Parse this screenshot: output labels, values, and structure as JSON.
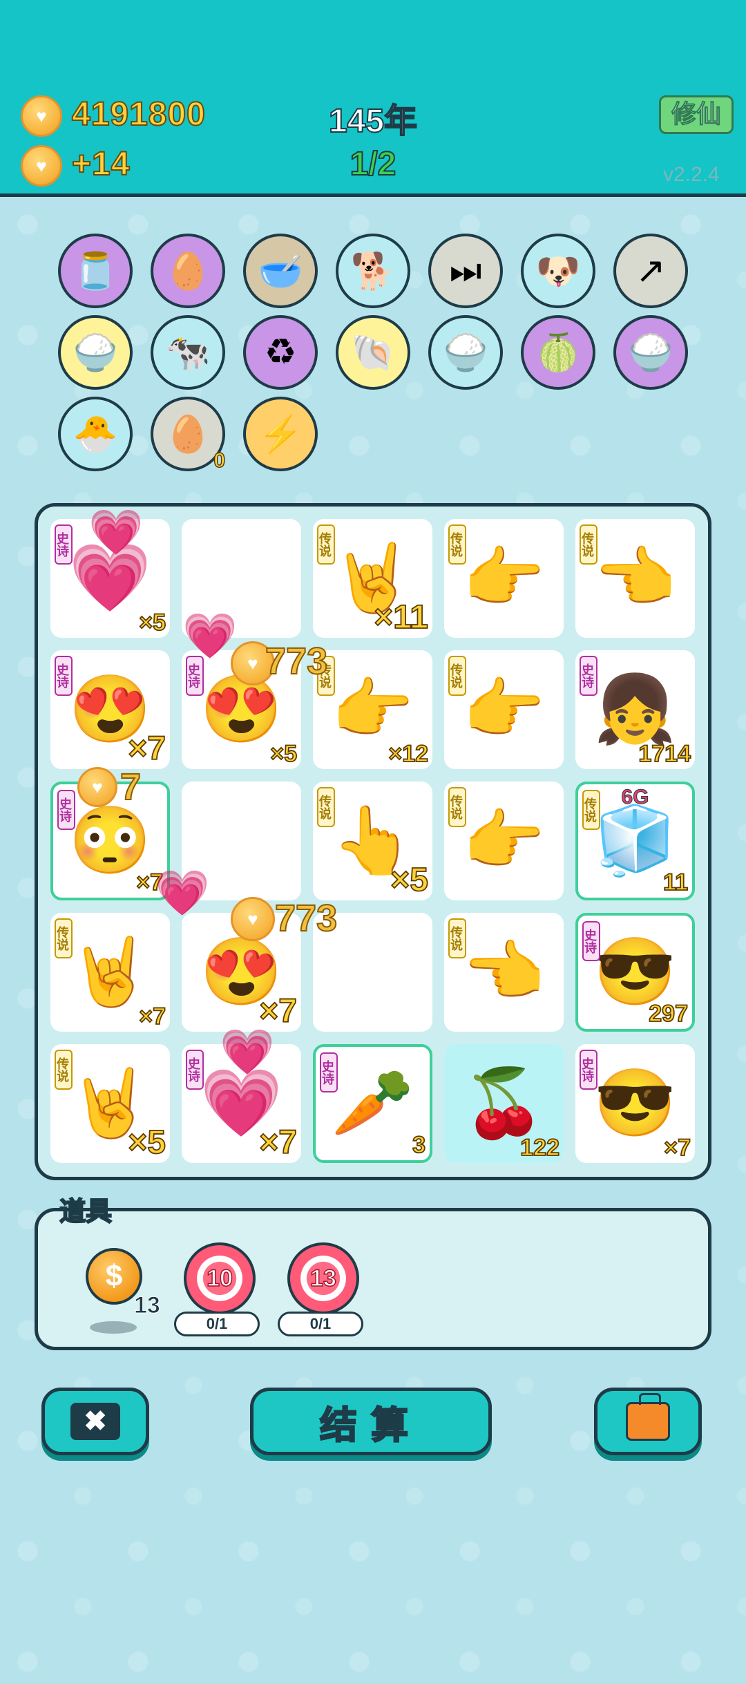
{
  "header": {
    "coins": "4191800",
    "income": "+14",
    "year": "145年",
    "progress": "1/2",
    "xiuxian_label": "修仙",
    "version": "v2.2.4"
  },
  "relics": [
    {
      "icon": "jar-icon",
      "glyph": "🫙",
      "color": "purple"
    },
    {
      "icon": "egg-icon",
      "glyph": "🥚",
      "color": "purple"
    },
    {
      "icon": "pet-food-bowl-icon",
      "glyph": "🥣",
      "color": "tan"
    },
    {
      "icon": "husky-dog-icon",
      "glyph": "🐕",
      "color": "cyan"
    },
    {
      "icon": "skip-icon",
      "glyph": "⏭",
      "color": "gray"
    },
    {
      "icon": "cool-dog-icon",
      "glyph": "🐶",
      "color": "cyan"
    },
    {
      "icon": "arrow-card-icon",
      "glyph": "↗",
      "color": "gray"
    },
    {
      "icon": "rice-bowl-icon",
      "glyph": "🍚",
      "color": "yellow"
    },
    {
      "icon": "cow-twins-icon",
      "glyph": "🐄",
      "color": "cyan"
    },
    {
      "icon": "recycle-icon",
      "glyph": "♻",
      "color": "purple"
    },
    {
      "icon": "shell-icon",
      "glyph": "🐚",
      "color": "yellow"
    },
    {
      "icon": "rice-bowl-icon",
      "glyph": "🍚",
      "color": "cyan"
    },
    {
      "icon": "eyepatch-fruit-icon",
      "glyph": "🍈",
      "color": "purple"
    },
    {
      "icon": "rice-bowl-icon",
      "glyph": "🍚",
      "color": "purple"
    },
    {
      "icon": "chick-egg-icon",
      "glyph": "🐣",
      "color": "cyan"
    },
    {
      "icon": "egg-carton-icon",
      "glyph": "🥚",
      "color": "gray",
      "count": "0"
    },
    {
      "icon": "lightning-icon",
      "glyph": "⚡",
      "color": "orange"
    }
  ],
  "board": {
    "tiles": [
      {
        "tag": "史诗",
        "tag_type": "epic",
        "icon": "heart-girl-icon",
        "glyph": "💗",
        "mult": "×5"
      },
      {
        "tag": "",
        "tag_type": "",
        "icon": "",
        "glyph": "",
        "mult": ""
      },
      {
        "tag": "传说",
        "tag_type": "legend",
        "icon": "rock-hand-icon",
        "glyph": "🤘",
        "mult": "×11",
        "big": true
      },
      {
        "tag": "传说",
        "tag_type": "legend",
        "icon": "point-hand-icon",
        "glyph": "👉",
        "mult": ""
      },
      {
        "tag": "传说",
        "tag_type": "legend",
        "icon": "point-hand-icon",
        "glyph": "👈",
        "mult": ""
      },
      {
        "tag": "史诗",
        "tag_type": "epic",
        "icon": "heart-eyes-man-icon",
        "glyph": "😍",
        "mult": "×7",
        "big": true
      },
      {
        "tag": "史诗",
        "tag_type": "epic",
        "icon": "heart-eyes-man-icon",
        "glyph": "😍",
        "mult": "×5"
      },
      {
        "tag": "传说",
        "tag_type": "legend",
        "icon": "point-hand-icon",
        "glyph": "👉",
        "mult": "×12"
      },
      {
        "tag": "传说",
        "tag_type": "legend",
        "icon": "point-hand-icon",
        "glyph": "👉",
        "mult": ""
      },
      {
        "tag": "史诗",
        "tag_type": "epic",
        "icon": "braided-girl-icon",
        "glyph": "👧",
        "mult": "1714"
      },
      {
        "tag": "史诗",
        "tag_type": "epic",
        "icon": "glowing-man-icon",
        "glyph": "😳",
        "mult": "×7",
        "green": true
      },
      {
        "tag": "",
        "tag_type": "",
        "icon": "",
        "glyph": "",
        "mult": ""
      },
      {
        "tag": "传说",
        "tag_type": "legend",
        "icon": "point-hand-icon",
        "glyph": "👆",
        "mult": "×5",
        "big": true
      },
      {
        "tag": "传说",
        "tag_type": "legend",
        "icon": "point-hand-icon",
        "glyph": "👉",
        "mult": ""
      },
      {
        "tag": "传说",
        "tag_type": "legend",
        "icon": "fridge-icon",
        "glyph": "🧊",
        "mult": "11",
        "green": true,
        "label": "6G"
      },
      {
        "tag": "传说",
        "tag_type": "legend",
        "icon": "rock-hand-icon",
        "glyph": "🤘",
        "mult": "×7"
      },
      {
        "tag": "",
        "tag_type": "",
        "icon": "heart-eyes-man-icon",
        "glyph": "😍",
        "mult": "×7",
        "big": true
      },
      {
        "tag": "",
        "tag_type": "",
        "icon": "",
        "glyph": "",
        "mult": ""
      },
      {
        "tag": "传说",
        "tag_type": "legend",
        "icon": "point-hand-icon",
        "glyph": "👈",
        "mult": ""
      },
      {
        "tag": "史诗",
        "tag_type": "epic",
        "icon": "sunglasses-man-icon",
        "glyph": "😎",
        "mult": "297",
        "green": true
      },
      {
        "tag": "传说",
        "tag_type": "legend",
        "icon": "rock-hand-icon",
        "glyph": "🤘",
        "mult": "×5",
        "big": true
      },
      {
        "tag": "史诗",
        "tag_type": "epic",
        "icon": "heart-girl-icon",
        "glyph": "💗",
        "mult": "×7",
        "big": true
      },
      {
        "tag": "史诗",
        "tag_type": "epic",
        "icon": "carrot-icon",
        "glyph": "🥕",
        "mult": "3",
        "green": true
      },
      {
        "tag": "",
        "tag_type": "",
        "icon": "cherries-icon",
        "glyph": "🍒",
        "mult": "122",
        "cyan": true
      },
      {
        "tag": "史诗",
        "tag_type": "epic",
        "icon": "sunglasses-man-icon",
        "glyph": "😎",
        "mult": "×7"
      }
    ],
    "fx_texts": [
      "773",
      "7",
      "773"
    ]
  },
  "items": {
    "title": "道具",
    "coin_count": "13",
    "ring1_value": "10",
    "ring1_uses": "0/1",
    "ring2_value": "13",
    "ring2_uses": "0/1"
  },
  "buttons": {
    "close_icon": "✖",
    "settle_label": "结算"
  }
}
